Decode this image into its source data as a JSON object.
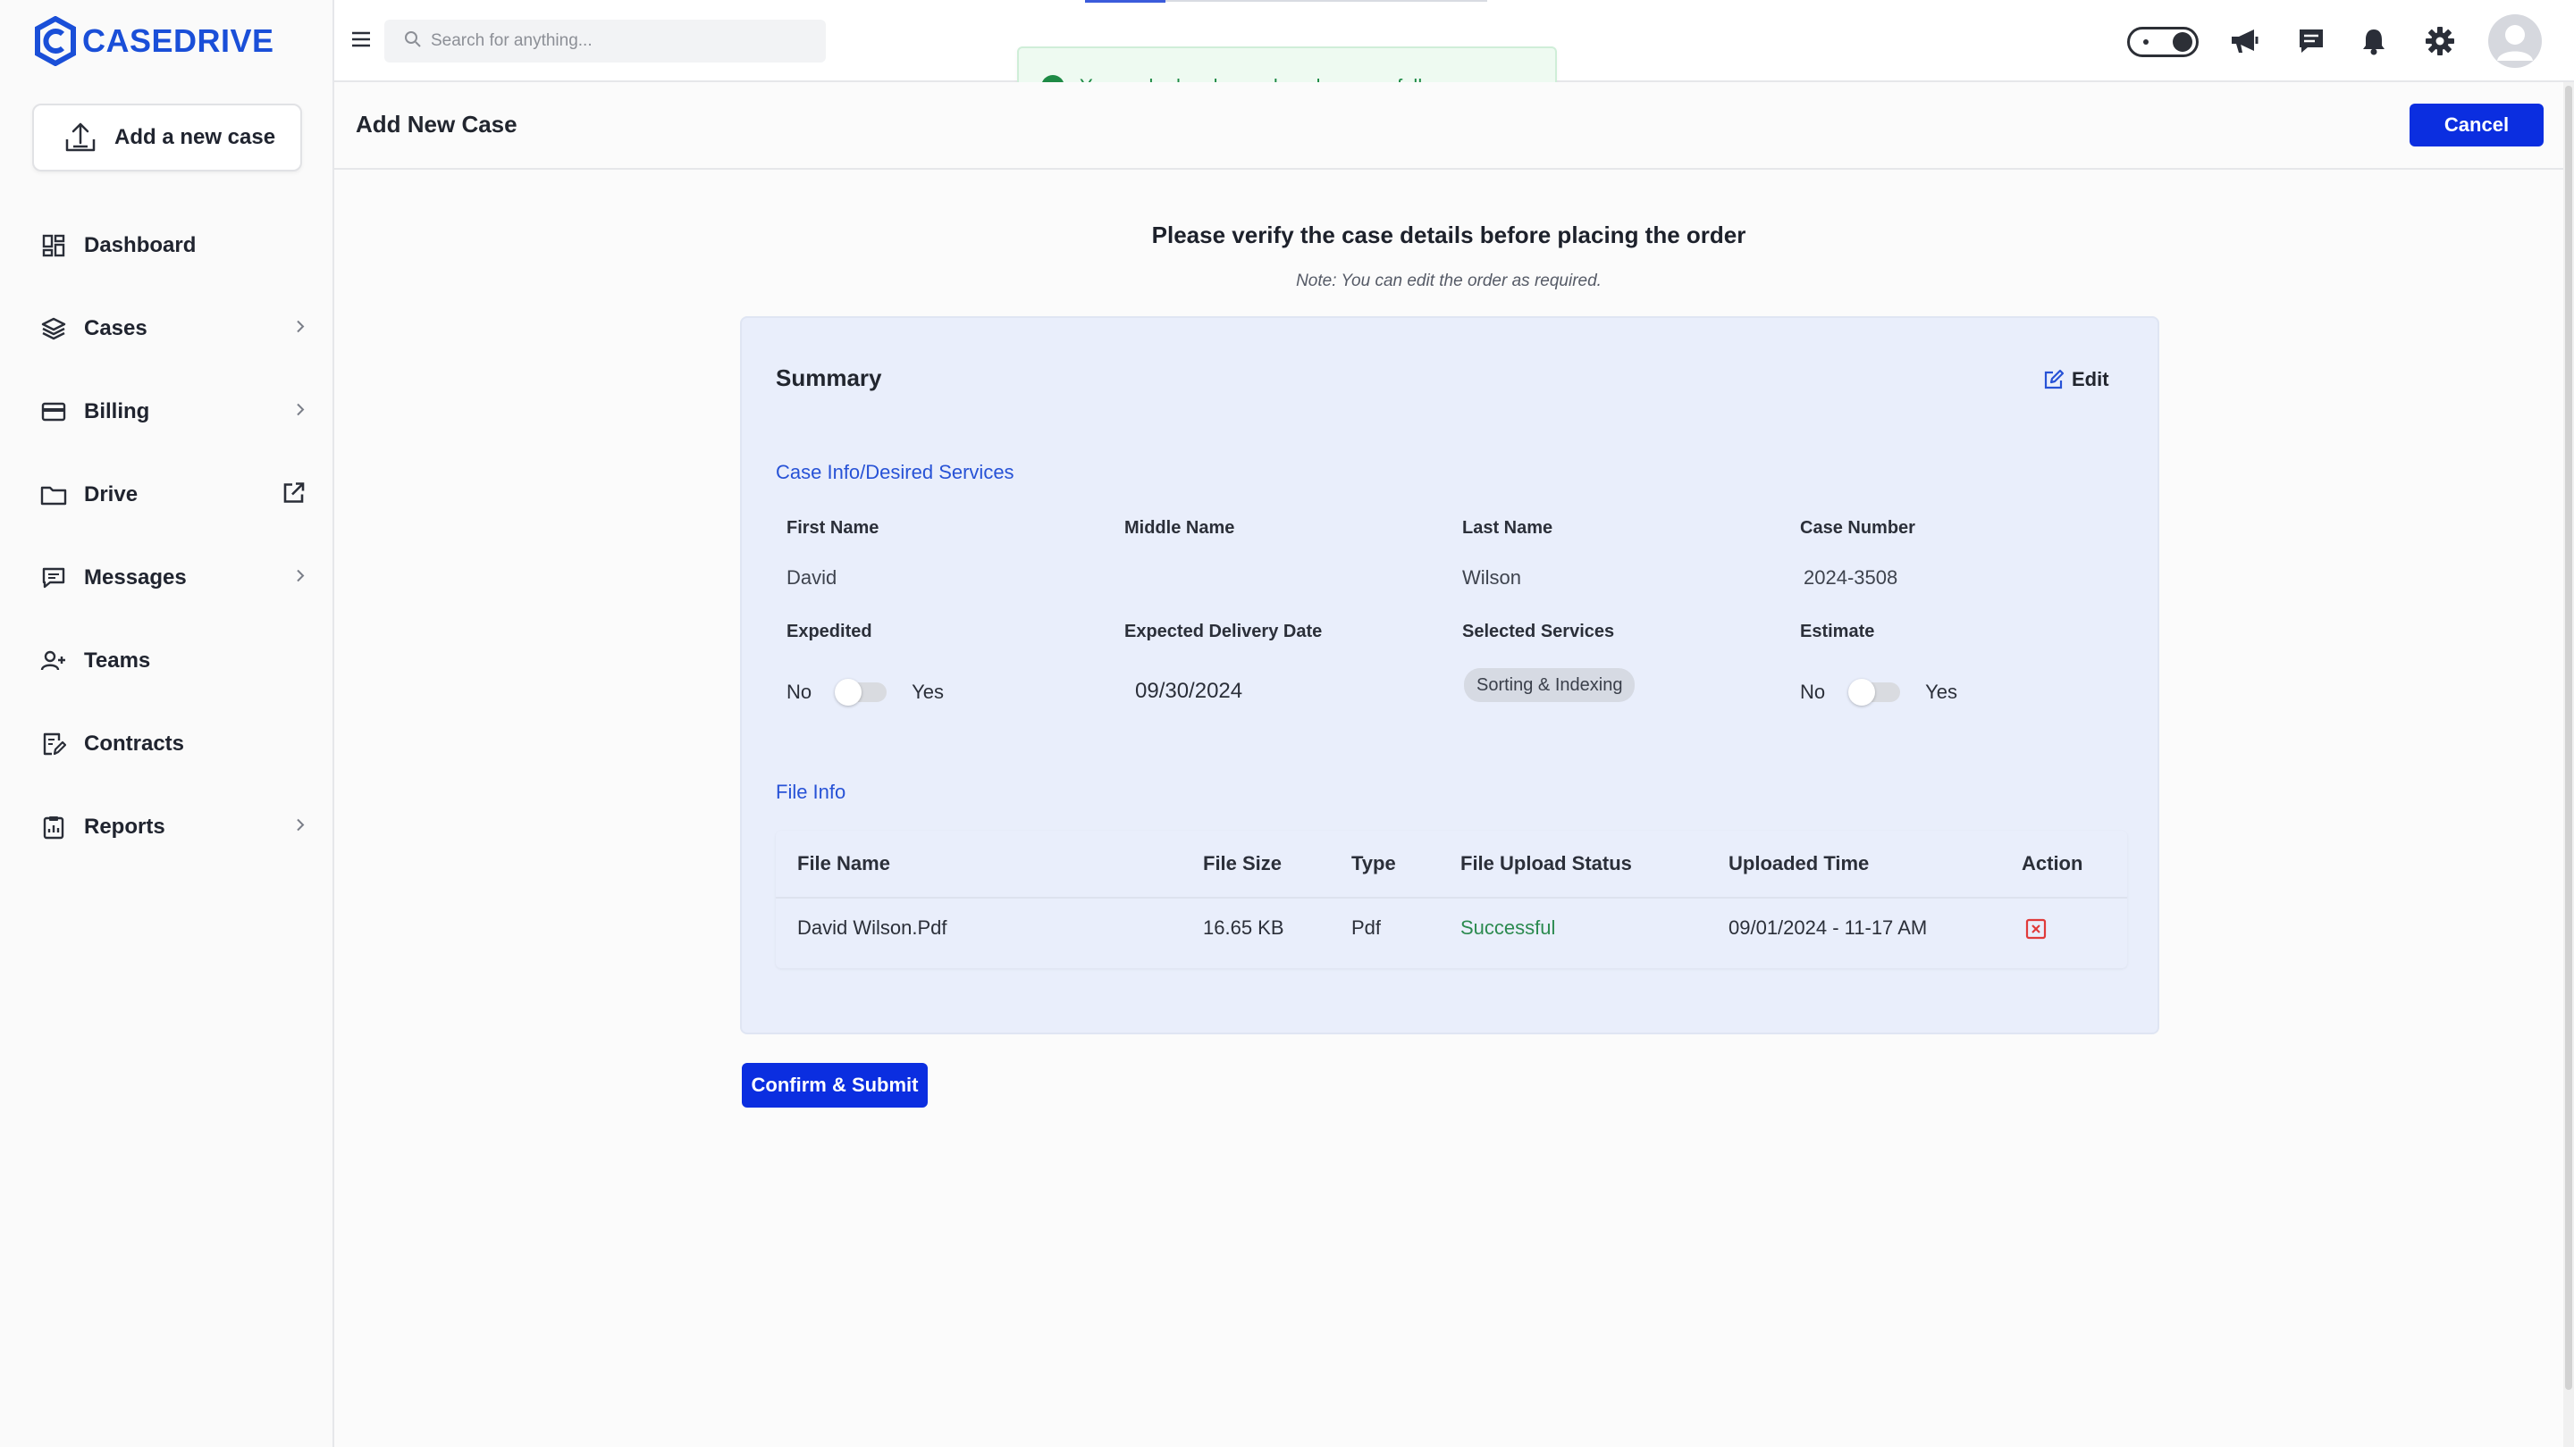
{
  "brand": {
    "name": "CASEDRIVE",
    "color": "#1a4fd8"
  },
  "sidebar": {
    "add_case_label": "Add a new case",
    "items": [
      {
        "label": "Dashboard",
        "icon": "dashboard-icon",
        "has_chevron": false
      },
      {
        "label": "Cases",
        "icon": "layers-icon",
        "has_chevron": true
      },
      {
        "label": "Billing",
        "icon": "credit-card-icon",
        "has_chevron": true
      },
      {
        "label": "Drive",
        "icon": "folder-icon",
        "external": true
      },
      {
        "label": "Messages",
        "icon": "message-icon",
        "has_chevron": true
      },
      {
        "label": "Teams",
        "icon": "users-icon",
        "has_chevron": false
      },
      {
        "label": "Contracts",
        "icon": "contract-icon",
        "has_chevron": false
      },
      {
        "label": "Reports",
        "icon": "clipboard-icon",
        "has_chevron": true
      }
    ]
  },
  "topbar": {
    "search_placeholder": "Search for anything...",
    "icons": [
      "theme-toggle-icon",
      "megaphone-icon",
      "chat-icon",
      "bell-icon",
      "gear-icon",
      "avatar-icon"
    ]
  },
  "toast": {
    "message": "Your order has been placed successfully.",
    "color": "#1e8a45"
  },
  "header": {
    "title": "Add New Case",
    "cancel_label": "Cancel"
  },
  "main": {
    "verify_title": "Please verify the case details before placing the order",
    "verify_note": "Note: You can edit the order as required.",
    "summary": {
      "title": "Summary",
      "edit_label": "Edit",
      "case_info_title": "Case Info/Desired Services",
      "fields": {
        "first_name": {
          "label": "First Name",
          "value": "David"
        },
        "middle_name": {
          "label": "Middle Name",
          "value": ""
        },
        "last_name": {
          "label": "Last Name",
          "value": "Wilson"
        },
        "case_number": {
          "label": "Case Number",
          "value": "2024-3508"
        },
        "expedited": {
          "label": "Expedited",
          "off_label": "No",
          "on_label": "Yes",
          "on": false
        },
        "delivery_date": {
          "label": "Expected Delivery Date",
          "value": "09/30/2024"
        },
        "selected_services": {
          "label": "Selected Services",
          "value": "Sorting & Indexing"
        },
        "estimate": {
          "label": "Estimate",
          "off_label": "No",
          "on_label": "Yes",
          "on": false
        }
      },
      "file_info_title": "File Info",
      "file_table": {
        "columns": [
          "File Name",
          "File Size",
          "Type",
          "File Upload Status",
          "Uploaded Time",
          "Action"
        ],
        "rows": [
          {
            "name": "David Wilson.Pdf",
            "size": "16.65 KB",
            "type": "Pdf",
            "status": "Successful",
            "time": "09/01/2024 - 11-17 AM",
            "action_icon": "delete-icon"
          }
        ]
      }
    },
    "confirm_label": "Confirm & Submit"
  },
  "colors": {
    "primary": "#0b2ee0",
    "link": "#2752d6",
    "success": "#2b8a4f",
    "danger": "#e03a3a"
  }
}
